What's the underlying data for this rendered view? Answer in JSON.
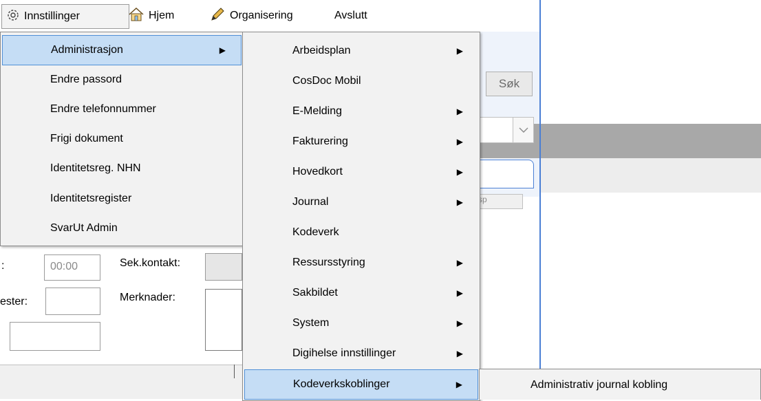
{
  "menubar": {
    "items": [
      {
        "label": "Innstillinger",
        "icon": "gear-icon"
      },
      {
        "label": "Hjem",
        "icon": "home-icon"
      },
      {
        "label": "Organisering",
        "icon": "pencil-icon"
      },
      {
        "label": "Avslutt"
      }
    ]
  },
  "background": {
    "search_button": "Søk",
    "tab_button_text": "sp",
    "time_value": "00:00",
    "label_colon": ":",
    "label_ester": "ester:",
    "label_sek": "Sek.kontakt:",
    "label_merk": "Merknader:"
  },
  "menu1": {
    "items": [
      {
        "label": "Administrasjon",
        "has_submenu": true,
        "selected": true
      },
      {
        "label": "Endre passord"
      },
      {
        "label": "Endre telefonnummer"
      },
      {
        "label": "Frigi dokument"
      },
      {
        "label": "Identitetsreg. NHN"
      },
      {
        "label": "Identitetsregister"
      },
      {
        "label": "SvarUt Admin"
      }
    ]
  },
  "menu2": {
    "items": [
      {
        "label": "Arbeidsplan",
        "has_submenu": true
      },
      {
        "label": "CosDoc Mobil"
      },
      {
        "label": "E-Melding",
        "has_submenu": true
      },
      {
        "label": "Fakturering",
        "has_submenu": true
      },
      {
        "label": "Hovedkort",
        "has_submenu": true
      },
      {
        "label": "Journal",
        "has_submenu": true
      },
      {
        "label": "Kodeverk"
      },
      {
        "label": "Ressursstyring",
        "has_submenu": true
      },
      {
        "label": "Sakbildet",
        "has_submenu": true
      },
      {
        "label": "System",
        "has_submenu": true
      },
      {
        "label": "Digihelse innstillinger",
        "has_submenu": true
      },
      {
        "label": "Kodeverkskoblinger",
        "has_submenu": true,
        "selected": true
      }
    ]
  },
  "menu3": {
    "items": [
      {
        "label": "Administrativ journal kobling"
      }
    ]
  },
  "colors": {
    "selection_bg": "#c5ddf5",
    "selection_border": "#4f8fd6",
    "menu_bg": "#f2f2f2",
    "accent_blue": "#4a7fd4"
  }
}
